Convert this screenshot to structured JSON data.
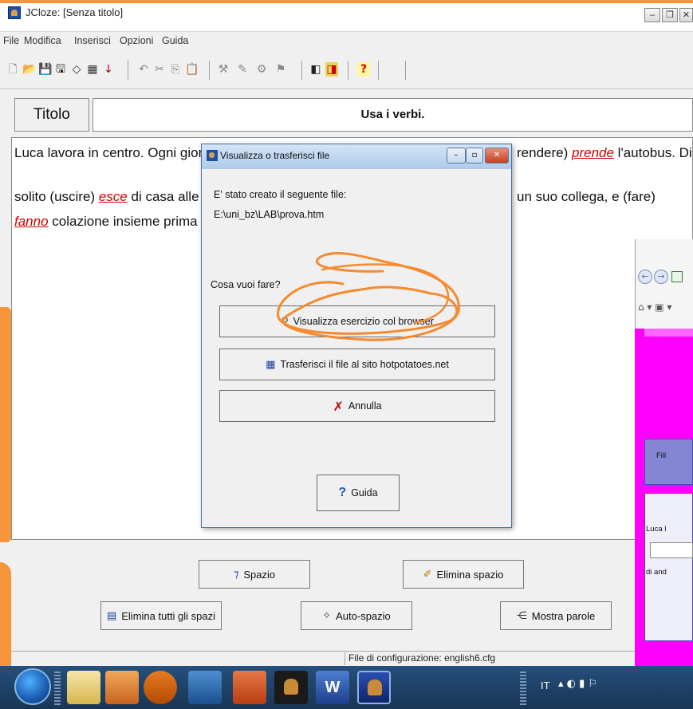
{
  "window": {
    "title": "JCloze: [Senza titolo]",
    "controls": [
      "‒",
      "❐",
      "✕"
    ]
  },
  "menu": [
    "File",
    "Modifica",
    "Inserisci",
    "Opzioni",
    "Guida"
  ],
  "title_row": {
    "label": "Titolo",
    "value": "Usa i verbi."
  },
  "text": {
    "line1_a": "Luca lavora in centro. Ogni gior",
    "line1_b": "rendere)",
    "line1_gap": "prende",
    "line1_c": "l'autobus. Di",
    "line2_a": "solito (uscire)",
    "line2_gap": "esce",
    "line2_b": "di casa alle",
    "line2_c": "un suo collega, e (fare)",
    "line3_gap": "fanno",
    "line3_a": "colazione insieme prima"
  },
  "dialog": {
    "title": "Visualizza o trasferisci file",
    "created_label": "E' stato creato il seguente file:",
    "file_path": "E:\\uni_bz\\LAB\\prova.htm",
    "question": "Cosa vuoi fare?",
    "btn_view": "Visualizza esercizio col browser",
    "btn_upload": "Trasferisci il file al sito hotpotatoes.net",
    "btn_cancel": "Annulla",
    "btn_help": "Guida"
  },
  "bottom_buttons": {
    "spazio": "Spazio",
    "elimina_spazio": "Elimina spazio",
    "elimina_tutti": "Elimina tutti gli spazi",
    "auto_spazio": "Auto-spazio",
    "mostra_parole": "Mostra parole"
  },
  "status": {
    "config": "File di configurazione: english6.cfg"
  },
  "browser_peek": {
    "label1": "Fill",
    "label2": "Luca l",
    "label3": "di and"
  },
  "taskbar": {
    "language": "IT"
  },
  "colors": {
    "gap_red": "#d00000",
    "slide_orange": "#f7943c",
    "browser_pink": "#ff00ff",
    "scribble": "#f58a2e"
  }
}
